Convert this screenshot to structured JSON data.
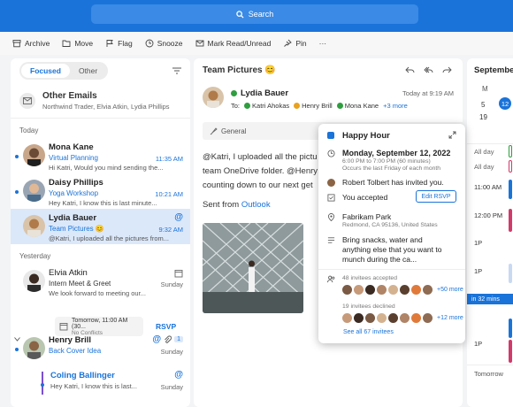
{
  "search": {
    "label": "Search"
  },
  "toolbar": {
    "archive": "Archive",
    "move": "Move",
    "flag": "Flag",
    "snooze": "Snooze",
    "mark": "Mark Read/Unread",
    "pin": "Pin",
    "more": "···"
  },
  "mail_list": {
    "tabs": {
      "focused": "Focused",
      "other": "Other"
    },
    "other_emails": {
      "title": "Other Emails",
      "senders": "Northwind Trader, Elvia Atkin, Lydia Phillips"
    },
    "section_today": "Today",
    "section_yesterday": "Yesterday",
    "items": [
      {
        "sender": "Mona Kane",
        "subject": "Virtual Planning",
        "preview": "Hi Katri, Would you mind sending the...",
        "time": "11:35 AM"
      },
      {
        "sender": "Daisy Phillips",
        "subject": "Yoga Workshop",
        "preview": "Hey Katri, I know this is last minute...",
        "time": "10:21 AM"
      },
      {
        "sender": "Lydia Bauer",
        "subject": "Team Pictures 😊",
        "preview": "@Katri, I uploaded all the pictures from...",
        "time": "9:32 AM",
        "mark": "@"
      },
      {
        "sender": "Elvia Atkin",
        "subject": "Intern Meet & Greet",
        "preview": "We look forward to meeting our...",
        "time": "Sunday"
      },
      {
        "sender": "Henry Brill",
        "subject": "Back Cover Idea",
        "preview": "",
        "time": "Sunday",
        "count": "1",
        "mark": "@"
      },
      {
        "sender": "Coling Ballinger",
        "subject": "",
        "preview": "Hey Katri, I know this is last...",
        "time": "Sunday",
        "mark": "@"
      }
    ],
    "rsvp_card": {
      "title": "Tomorrow, 11:00 AM (30...",
      "sub": "No Conflicts"
    },
    "rsvp_button": "RSVP"
  },
  "reading": {
    "title": "Team Pictures 😊",
    "from": "Lydia Bauer",
    "timestamp": "Today at 9:19 AM",
    "to_label": "To:",
    "recipients": [
      "Katri Ahokas",
      "Henry Brill",
      "Mona Kane"
    ],
    "more_recipients": "+3 more",
    "channel": "General",
    "body": [
      "@Katri, I uploaded all the pictu",
      "team OneDrive folder. @Henry",
      "counting down to our next get"
    ],
    "mention1": "@Katri",
    "mention2": "@Henry",
    "sent_from": "Sent from",
    "sent_from_link": "Outlook"
  },
  "event": {
    "title": "Happy Hour",
    "date": "Monday, September 12, 2022",
    "time": "6:00 PM to 7:00 PM (60 minutes)",
    "recurrence": "Occurs the last Friday of each month",
    "invited_by": "Robert Tolbert has invited you.",
    "status": "You accepted",
    "edit_rsvp": "Edit RSVP",
    "location": "Fabrikam Park",
    "address": "Redmond, CA 95136, United States",
    "notes": [
      "Bring snacks, water and",
      "anything else that you want to",
      "munch during the ca..."
    ],
    "accepted_label": "48 invitees accepted",
    "accepted_more": "+50 more",
    "declined_label": "19 invitees declined",
    "declined_more": "+12 more",
    "see_all": "See all 67 invitees"
  },
  "calendar": {
    "month": "September",
    "weekday": "M",
    "days": [
      "5",
      "12",
      "19"
    ],
    "all_day": "All day",
    "times": [
      "11:00 AM",
      "12:00 PM",
      "1P",
      "1P",
      "1P",
      "1P"
    ],
    "now": "in 32 mins",
    "tomorrow": "Tomorrow"
  },
  "colors": {
    "accent": "#1a73d9",
    "selection": "#dbe8fa",
    "now": "#1a73d9"
  }
}
